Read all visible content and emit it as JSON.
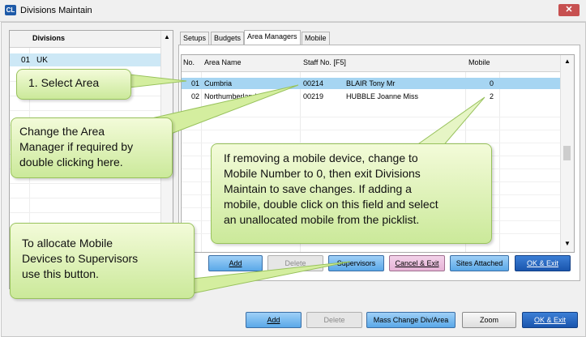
{
  "window": {
    "app_icon": "CL",
    "title": "Divisions Maintain",
    "close": "✕"
  },
  "divisions": {
    "header": "Divisions",
    "rows": [
      {
        "no": "01",
        "name": "UK"
      }
    ],
    "scroll_up": "▲"
  },
  "tabs": [
    "Setups",
    "Budgets",
    "Area Managers",
    "Mobile"
  ],
  "grid": {
    "headers": {
      "no": "No.",
      "area": "Area Name",
      "staff": "Staff No. [F5]",
      "mobile": "Mobile"
    },
    "rows": [
      {
        "no": "01",
        "area": "Cumbria",
        "staff_no": "00214",
        "staff_name": "BLAIR Tony Mr",
        "mobile": "0"
      },
      {
        "no": "02",
        "area": "Northumberland",
        "staff_no": "00219",
        "staff_name": "HUBBLE Joanne Miss",
        "mobile": "2"
      }
    ],
    "scroll_up": "▲",
    "scroll_down": "▼"
  },
  "tab_buttons": {
    "add": "Add",
    "delete": "Delete",
    "supervisors": "Supervisors",
    "cancel_exit": "Cancel & Exit",
    "sites_attached": "Sites Attached",
    "ok_exit": "OK & Exit"
  },
  "footer_buttons": {
    "add": "Add",
    "delete": "Delete",
    "mass_change": "Mass Change Div/Area",
    "zoom": "Zoom",
    "ok_exit": "OK & Exit"
  },
  "callouts": {
    "select_area": "1. Select Area",
    "change_manager": [
      "Change the Area",
      "Manager if required by",
      "double clicking here."
    ],
    "mobile_device": [
      "If removing a mobile device, change to",
      "Mobile Number to 0, then exit Divisions",
      "Maintain to save changes.  If adding a",
      "mobile, double click on this field and select",
      "an unallocated mobile from the picklist."
    ],
    "supervisors": [
      "To allocate Mobile",
      "Devices to Supervisors",
      "use this button."
    ]
  }
}
